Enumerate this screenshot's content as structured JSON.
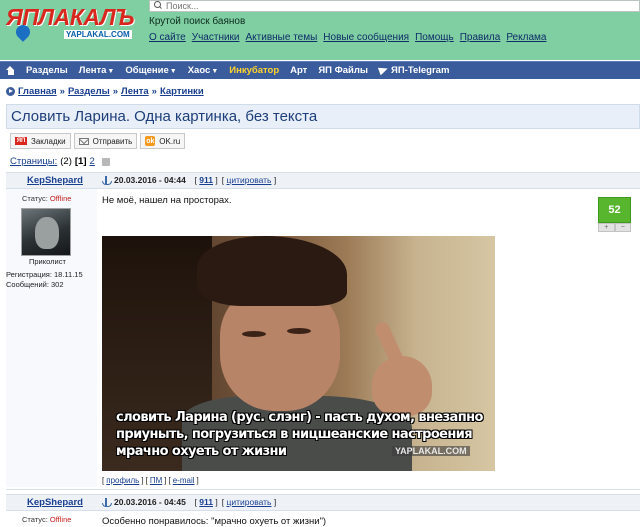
{
  "header": {
    "logo_text": "ЯПЛАКАЛЪ",
    "logo_sub": "YAPLAKAL.COM",
    "search_placeholder": "Поиск...",
    "tagline": "Крутой поиск баянов",
    "links": [
      "О сайте",
      "Участники",
      "Активные темы",
      "Новые сообщения",
      "Помощь",
      "Правила",
      "Реклама"
    ]
  },
  "nav": {
    "items": [
      {
        "label": "Разделы",
        "caret": false,
        "highlight": false
      },
      {
        "label": "Лента",
        "caret": true,
        "highlight": false
      },
      {
        "label": "Общение",
        "caret": true,
        "highlight": false
      },
      {
        "label": "Хаос",
        "caret": true,
        "highlight": false
      },
      {
        "label": "Инкубатор",
        "caret": false,
        "highlight": true
      },
      {
        "label": "Арт",
        "caret": false,
        "highlight": false
      },
      {
        "label": "ЯП Файлы",
        "caret": false,
        "highlight": false
      }
    ],
    "telegram": "ЯП-Telegram",
    "caret_glyph": "▼"
  },
  "breadcrumb": {
    "items": [
      "Главная",
      "Разделы",
      "Лента",
      "Картинки"
    ],
    "separator": "»"
  },
  "topic": {
    "title": "Словить Ларина. Одна картинка, без текста"
  },
  "share": {
    "bookmarks": "Закладки",
    "send": "Отправить",
    "ok": "OK.ru",
    "yap_icon_text": "ЯП",
    "ok_icon_text": "ok"
  },
  "pages": {
    "label": "Страницы:",
    "count": "(2)",
    "current": "[1]",
    "next": "2"
  },
  "posts": [
    {
      "author": "KepShepard",
      "date": "20.03.2016 - 04:44",
      "number": "911",
      "quote": "цитировать",
      "status_label": "Статус:",
      "status_value": "Offline",
      "user_title": "Приколист",
      "reg": "Регистрация: 18.11.15",
      "messages": "Сообщений: 302",
      "text": "Не моё, нашел на просторах.",
      "rating": "52",
      "rating_plus": "+",
      "rating_minus": "−",
      "image_caption": "словить Ларина (рус. слэнг) - пасть духом, внезапно приуныть, погрузиться в ницшеанские настроения мрачно охуеть от жизни",
      "image_watermark": "YAPLAKAL.COM",
      "links": [
        "профиль",
        "ПМ",
        "e-mail"
      ]
    },
    {
      "author": "KepShepard",
      "date": "20.03.2016 - 04:45",
      "number": "911",
      "quote": "цитировать",
      "status_label": "Статус:",
      "status_value": "Offline",
      "text": "Особенно понравилось: \"мрачно охуеть от жизни\")"
    }
  ],
  "colors": {
    "header_bg": "#7fcfa3",
    "nav_bg": "#3a5b9c",
    "logo_red": "#d9271e",
    "rating_green": "#57b52e"
  }
}
